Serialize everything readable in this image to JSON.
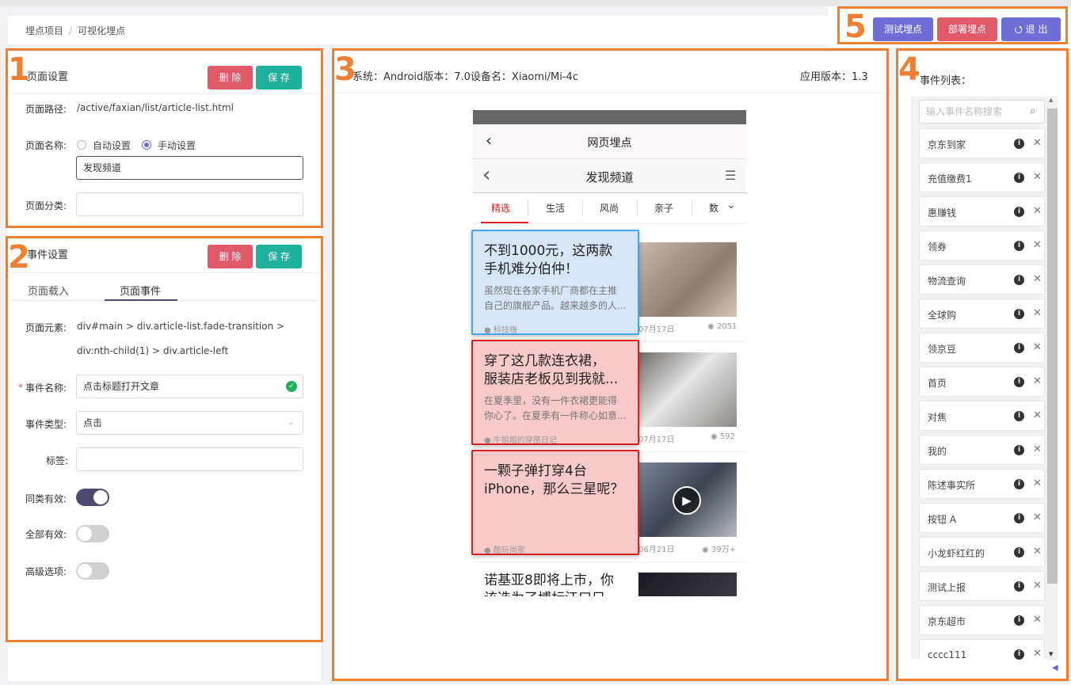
{
  "breadcrumb": {
    "root": "埋点项目",
    "separator": "/",
    "current": "可视化埋点"
  },
  "top_actions": {
    "test_label": "测试埋点",
    "deploy_label": "部署埋点",
    "logout_label": "退 出"
  },
  "annotations": {
    "n1": "1",
    "n2": "2",
    "n3": "3",
    "n4": "4",
    "n5": "5"
  },
  "page_settings": {
    "title": "页面设置",
    "delete_label": "删 除",
    "save_label": "保 存",
    "path_label": "页面路径:",
    "path_value": "/active/faxian/list/article-list.html",
    "name_label": "页面名称:",
    "auto_label": "自动设置",
    "manual_label": "手动设置",
    "name_value": "发现频道",
    "category_label": "页面分类:",
    "category_value": ""
  },
  "event_settings": {
    "title": "事件设置",
    "delete_label": "删 除",
    "save_label": "保 存",
    "tabs": [
      "页面载入",
      "页面事件"
    ],
    "active_tab": "页面事件",
    "element_label": "页面元素:",
    "element_line1": "div#main > div.article-list.fade-transition >",
    "element_line2": "div:nth-child(1) > div.article-left",
    "required_mark": "*",
    "event_name_label": "事件名称:",
    "event_name_value": "点击标题打开文章",
    "event_type_label": "事件类型:",
    "event_type_value": "点击",
    "tag_label": "标签:",
    "tag_value": "",
    "same_class_label": "同类有效:",
    "same_class_on": true,
    "all_label": "全部有效:",
    "all_on": false,
    "advanced_label": "高级选项:",
    "advanced_on": false
  },
  "preview": {
    "system_info": "系统：Android版本：7.0设备名：Xiaomi/Mi-4c",
    "app_version": "应用版本：1.3",
    "header_title": "网页埋点",
    "nav_title": "发现频道",
    "tabs": [
      "精选",
      "生活",
      "风尚",
      "亲子",
      "数"
    ],
    "active_tab": "精选",
    "articles": [
      {
        "title_l1": "不到1000元，这两款",
        "title_l2": "手机难分伯仲！",
        "desc_l1": "虽然现在各家手机厂商都在主推",
        "desc_l2": "自己的旗舰产品。越来越多的人...",
        "source": "科技嗨",
        "date": "07月17日",
        "views": "2051"
      },
      {
        "title_l1": "穿了这几款连衣裙，",
        "title_l2": "服装店老板见到我就...",
        "desc_l1": "在夏季里，没有一件衣裙更能得",
        "desc_l2": "你心了。在夏季有一件称心如意...",
        "source": "牛姐姐的穿搭日记",
        "date": "07月17日",
        "views": "592"
      },
      {
        "title_l1": "一颗子弹打穿4台",
        "title_l2": "iPhone，那么三星呢？",
        "source": "酷玩尚家",
        "date": "06月21日",
        "views": "39万+"
      },
      {
        "title_l1": "诺基亚8即将上市，你",
        "title_l2": "该选为了博标江口只"
      }
    ]
  },
  "event_list": {
    "title": "事件列表：",
    "search_placeholder": "输入事件名称搜索",
    "items": [
      "京东到家",
      "充值缴费1",
      "惠赚钱",
      "领券",
      "物流查询",
      "全球购",
      "领京豆",
      "首页",
      "对焦",
      "我的",
      "陈述事实所",
      "按钮 A",
      "小龙虾红红的",
      "测试上报",
      "京东超市",
      "cccc111"
    ]
  },
  "colors": {
    "annotation": "#ee7f33",
    "danger": "#e05a6a",
    "success": "#1fb19c",
    "primary": "#6e6ed6",
    "selected_card": "#d6e6f7",
    "highlight_card": "#f8c9c9"
  }
}
